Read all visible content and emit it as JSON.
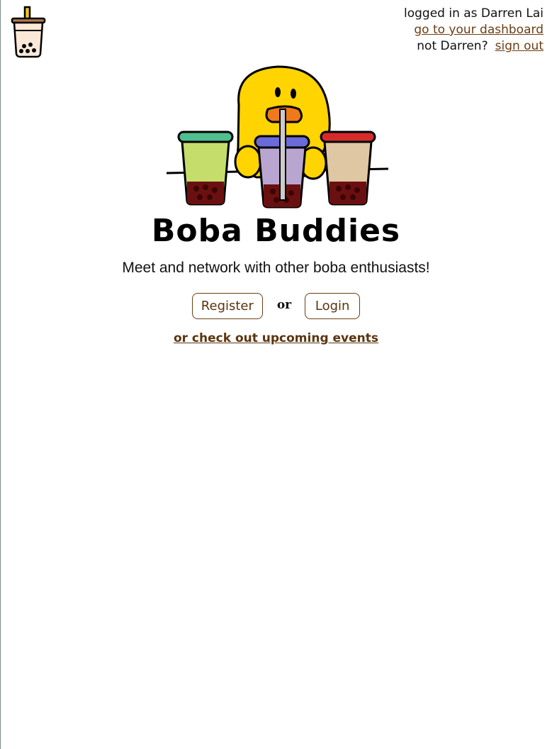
{
  "header": {
    "logged_in_text": "logged in as Darren Lai",
    "dashboard_link": "go to your dashboard",
    "not_user_text": "not Darren?",
    "sign_out_link": "sign out"
  },
  "icons": {
    "logo": "boba-cup-icon",
    "hero": "duck-with-boba-cups-illustration"
  },
  "hero": {
    "title": "Boba Buddies",
    "tagline": "Meet and network with other boba enthusiasts!"
  },
  "actions": {
    "register_label": "Register",
    "or_label": "or",
    "login_label": "Login",
    "events_link": "or check out upcoming events"
  },
  "colors": {
    "link": "#6b3e12",
    "button_border": "#6b3e12",
    "duck_yellow": "#ffd400",
    "cup_green_lid": "#4fbf8f",
    "cup_purple_lid": "#6a6ad8",
    "cup_red_lid": "#d62b2b"
  }
}
